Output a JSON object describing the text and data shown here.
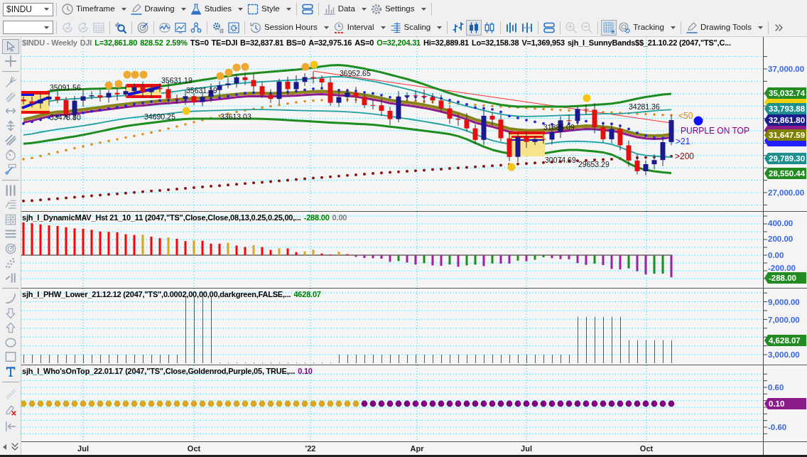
{
  "toolbar_1": {
    "symbol": "$INDU",
    "groups": [
      [
        {
          "kind": "menu",
          "label": "Timeframe"
        },
        {
          "kind": "menu",
          "label": "Drawing"
        },
        {
          "kind": "menu",
          "label": "Studies"
        },
        {
          "kind": "menu",
          "label": "Style"
        }
      ],
      [
        {
          "kind": "icon"
        }
      ],
      [
        {
          "kind": "menu",
          "label": "Data"
        },
        {
          "kind": "menu",
          "label": "Settings"
        }
      ]
    ]
  },
  "toolbar_2": {
    "groups": [
      [
        {
          "kind": "icon",
          "disabled": true
        },
        {
          "kind": "icon",
          "disabled": true
        },
        {
          "kind": "icon",
          "disabled": true
        }
      ],
      [
        {
          "kind": "icon",
          "disabled": false
        }
      ],
      [
        {
          "kind": "icon",
          "disabled": false
        }
      ],
      [
        {
          "kind": "icon",
          "disabled": false
        },
        {
          "kind": "icon",
          "disabled": false
        },
        {
          "kind": "icon",
          "disabled": false
        }
      ],
      [
        {
          "kind": "icon",
          "disabled": false
        },
        {
          "kind": "icon",
          "disabled": false
        }
      ],
      [
        {
          "kind": "menu",
          "label": "Session Hours"
        },
        {
          "kind": "menu",
          "label": "Interval"
        },
        {
          "kind": "menu",
          "label": "Scaling"
        }
      ],
      [
        {
          "kind": "icon",
          "disabled": false,
          "selected": false
        },
        {
          "kind": "icon",
          "disabled": false,
          "selected": true
        },
        {
          "kind": "icon",
          "disabled": false,
          "selected": false
        }
      ],
      [
        {
          "kind": "icon",
          "disabled": false
        },
        {
          "kind": "icon",
          "disabled": false
        }
      ],
      [
        {
          "kind": "icon",
          "disabled": false
        }
      ],
      [
        {
          "kind": "icon",
          "disabled": true
        },
        {
          "kind": "icon",
          "disabled": true
        }
      ],
      [
        {
          "kind": "icon",
          "disabled": false,
          "selected": true
        },
        {
          "kind": "menu",
          "label": "Tracking"
        }
      ],
      [
        {
          "kind": "menu",
          "label": "Drawing Tools"
        }
      ],
      [
        {
          "kind": "icon",
          "disabled": false
        }
      ]
    ]
  },
  "drawing_tools": [
    [
      {
        "selected": true
      },
      {
        "selected": false
      }
    ],
    [
      {
        "selected": false
      },
      {
        "selected": false
      },
      {
        "selected": false
      },
      {
        "selected": false
      },
      {
        "selected": false
      },
      {
        "selected": false
      },
      {
        "selected": false
      }
    ],
    [
      {
        "selected": false
      },
      {
        "selected": false
      },
      {
        "selected": false
      },
      {
        "selected": false
      },
      {
        "selected": false
      },
      {
        "selected": false
      },
      {
        "selected": false
      }
    ],
    [
      {
        "selected": false
      },
      {
        "selected": false
      },
      {
        "selected": false
      },
      {
        "selected": false
      },
      {
        "selected": false
      },
      {
        "selected": false
      }
    ],
    [
      {
        "selected": false
      },
      {
        "selected": false
      },
      {
        "selected": false
      }
    ]
  ],
  "chart": {
    "price_pane": {
      "header": [
        {
          "text": "$INDU - Weekly",
          "color": "#808080"
        },
        {
          "text": "DJI",
          "color": "#808080"
        },
        {
          "text": "L=32,861.80",
          "color": "#008000"
        },
        {
          "text": "828.52",
          "color": "#008000"
        },
        {
          "text": "2.59%",
          "color": "#008000"
        },
        {
          "text": "TS=0",
          "color": "#000000"
        },
        {
          "text": "TE=DJI",
          "color": "#000000"
        },
        {
          "text": "B=32,837.81",
          "color": "#000000"
        },
        {
          "text": "BS=0",
          "color": "#000000"
        },
        {
          "text": "A=32,975.16",
          "color": "#000000"
        },
        {
          "text": "AS=0",
          "color": "#000000"
        },
        {
          "text": "O=32,204.31",
          "color": "#008000"
        },
        {
          "text": "Hi=32,889.81",
          "color": "#000000"
        },
        {
          "text": "Lo=32,158.38",
          "color": "#000000"
        },
        {
          "text": "V=1,369,953",
          "color": "#000000"
        },
        {
          "text": "sjh_I_SunnyBands$$_21.10.22 (2047,\"TS\",C...",
          "color": "#000000"
        }
      ],
      "annotations": [
        "36952.65",
        "35631.19",
        "35091.56",
        "35631.19",
        "34281.36",
        "33478.80",
        "34690.25",
        "33613.03",
        "31885.09",
        "30074.69",
        "29653.29"
      ],
      "legend": [
        {
          "text": "<50",
          "color": "#e08a00"
        },
        {
          "text": "PURPLE ON TOP",
          "color": "#8b008b"
        },
        {
          "text": ">21",
          "color": "#1f1fff"
        },
        {
          "text": ">200",
          "color": "#8b0000"
        }
      ],
      "axis_labels": [
        "37,000.00",
        "27,000.00"
      ],
      "value_tags": [
        {
          "text": "35,032.74",
          "color": "#228b22"
        },
        {
          "color": "#f2d00a"
        },
        {
          "text": "33,793.88",
          "color": "#1e8f8f"
        },
        {
          "text": "32,861.80",
          "color": "#1c1c8c"
        },
        {
          "color": "#8b1a8b"
        },
        {
          "text": "31,647.59",
          "color": "#808000"
        },
        {
          "color": "#1f1fff"
        },
        {
          "text": "29,789.30",
          "color": "#1e8f8f"
        },
        {
          "text": "28,550.44",
          "color": "#228b22"
        }
      ]
    },
    "indicator_panes": [
      {
        "kind": "histogram",
        "header": [
          {
            "text": "sjh_I_DynamicMAV_Hst 21_10_11 (2047,\"TS\",Close,Close,08,13,0.25,0.25,00,...",
            "color": "#000000"
          },
          {
            "text": "-288.00",
            "color": "#008000"
          },
          {
            "text": "0.00",
            "color": "#808080"
          }
        ],
        "axis_labels": [
          "400.00",
          "200.00",
          "0.00",
          "-200.00"
        ],
        "value_tags": [
          {
            "text": "-288.00",
            "color": "#228b22"
          }
        ]
      },
      {
        "kind": "spikes",
        "header": [
          {
            "text": "sjh_I_PHW_Lower_21.12.12 (2047,\"TS\",0.0002,00,00,00,darkgreen,FALSE,...",
            "color": "#000000"
          },
          {
            "text": "4628.07",
            "color": "#008000"
          }
        ],
        "axis_labels": [
          "9,000.00",
          "7,000.00",
          "3,000.00"
        ],
        "value_tags": [
          {
            "text": "4,628.07",
            "color": "#228b22"
          }
        ]
      },
      {
        "kind": "dots",
        "header": [
          {
            "text": "sjh_I_Who'sOnTop_22.01.17 (2047,\"TS\",Close,Goldenrod,Purple,05, TRUE,...",
            "color": "#000000"
          },
          {
            "text": "0.10",
            "color": "#800080"
          }
        ],
        "axis_labels": [
          "0.60",
          "-0.60"
        ],
        "value_tags": [
          {
            "text": "0.10",
            "color": "#8b1a8b"
          }
        ]
      }
    ],
    "time_axis": [
      "Jul",
      "Oct",
      "'22",
      "Apr",
      "Jul",
      "Oct"
    ]
  }
}
